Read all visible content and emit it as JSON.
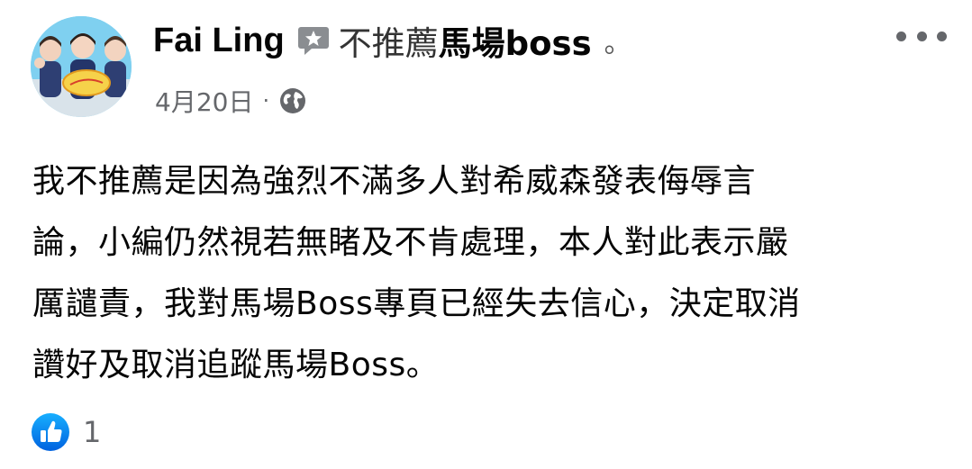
{
  "post": {
    "author": "Fai Ling",
    "status_prefix": "不推薦",
    "status_page": "馬場boss",
    "status_suffix": "。",
    "date": "4月20日",
    "separator": "·",
    "privacy_icon": "globe-icon",
    "body_lines": [
      "我不推薦是因為強烈不滿多人對希威森發表侮辱言",
      "論，小編仍然視若無睹及不肯處理，本人對此表示嚴",
      "厲譴責，我對馬場Boss專頁已經失去信心，決定取消",
      "讚好及取消追蹤馬場Boss。"
    ],
    "reactions": {
      "icon": "like-icon",
      "count": "1"
    }
  },
  "colors": {
    "text": "#050505",
    "secondary": "#65676b",
    "like_blue": "#1877f2"
  }
}
